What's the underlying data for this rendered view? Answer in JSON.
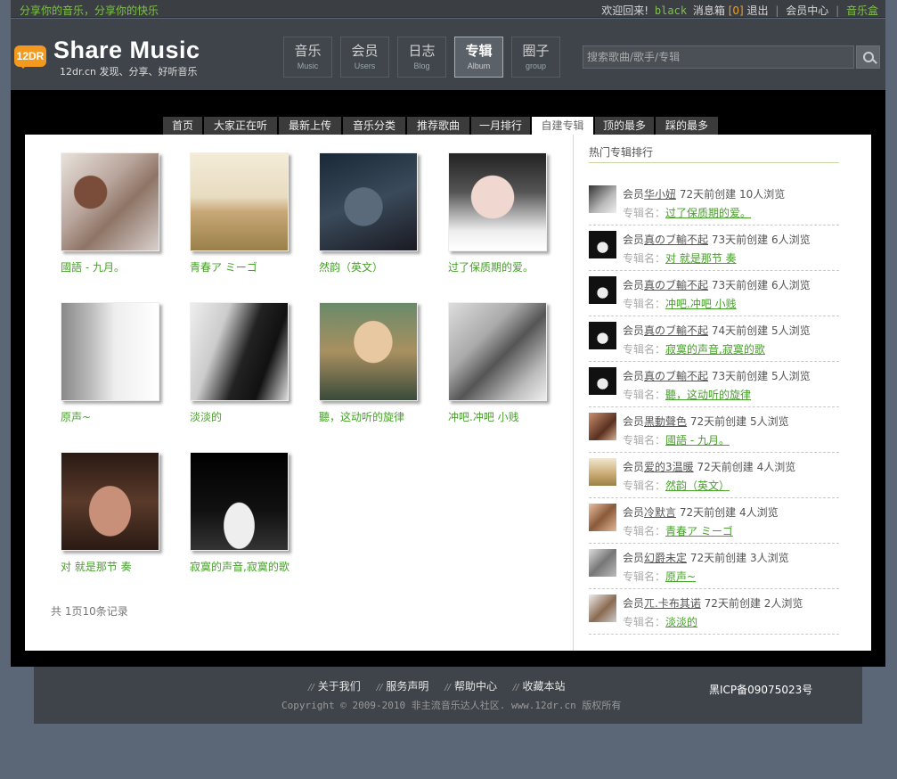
{
  "topbar": {
    "slogan": "分享你的音乐，分享你的快乐",
    "welcome": "欢迎回来!",
    "username": "black",
    "inbox_label": "消息箱",
    "inbox_count": "[0]",
    "logout": "退出",
    "member_center": "会员中心",
    "music_box": "音乐盒"
  },
  "header": {
    "logo_badge": "12DR",
    "logo_title": "Share Music",
    "logo_sub": "12dr.cn 发现、分享、好听音乐",
    "nav": [
      {
        "cn": "音乐",
        "en": "Music"
      },
      {
        "cn": "会员",
        "en": "Users"
      },
      {
        "cn": "日志",
        "en": "Blog"
      },
      {
        "cn": "专辑",
        "en": "Album"
      },
      {
        "cn": "圈子",
        "en": "group"
      }
    ],
    "active_nav": "Album",
    "search_placeholder": "搜索歌曲/歌手/专辑"
  },
  "subnav": [
    "首页",
    "大家正在听",
    "最新上传",
    "音乐分类",
    "推荐歌曲",
    "一月排行",
    "自建专辑",
    "顶的最多",
    "踩的最多"
  ],
  "subnav_active": "自建专辑",
  "albums": [
    {
      "title": "國語 - 九月。",
      "thumb": "photo-girl-with-record"
    },
    {
      "title": "青春ア ミーゴ",
      "thumb": "photo-field-couple"
    },
    {
      "title": "然韵（英文）",
      "thumb": "photo-dark-face"
    },
    {
      "title": "过了保质期的爱。",
      "thumb": "photo-girl-closeup"
    },
    {
      "title": "原声~",
      "thumb": "photo-girl-bw-side"
    },
    {
      "title": "淡淡的",
      "thumb": "photo-bw-hair"
    },
    {
      "title": "聽，这动听的旋律",
      "thumb": "photo-girl-headphones"
    },
    {
      "title": "冲吧.冲吧 小贱",
      "thumb": "photo-hand-strings"
    },
    {
      "title": "对 就是那节 奏",
      "thumb": "photo-girl-dark-eyes"
    },
    {
      "title": "寂寞的声音,寂寞的歌",
      "thumb": "photo-bw-crouching"
    }
  ],
  "pager": "共 1页10条记录",
  "hot": {
    "title": "热门专辑排行",
    "label_member": "会员",
    "label_album": "专辑名：",
    "items": [
      {
        "member": "华小妞",
        "created": "72天前创建",
        "views": "10人浏览",
        "album": "过了保质期的爱。"
      },
      {
        "member": "真のブ輸不起",
        "created": "73天前创建",
        "views": "6人浏览",
        "album": "对 就是那节 奏"
      },
      {
        "member": "真のブ輸不起",
        "created": "73天前创建",
        "views": "6人浏览",
        "album": "冲吧.冲吧 小贱"
      },
      {
        "member": "真のブ輸不起",
        "created": "74天前创建",
        "views": "5人浏览",
        "album": "寂寞的声音,寂寞的歌"
      },
      {
        "member": "真のブ輸不起",
        "created": "73天前创建",
        "views": "5人浏览",
        "album": "聽，这动听的旋律"
      },
      {
        "member": "黒動聲色",
        "created": "72天前创建",
        "views": "5人浏览",
        "album": "國語 - 九月。"
      },
      {
        "member": "爱的3温暖",
        "created": "72天前创建",
        "views": "4人浏览",
        "album": "然韵（英文）"
      },
      {
        "member": "冷默言",
        "created": "72天前创建",
        "views": "4人浏览",
        "album": "青春ア ミーゴ"
      },
      {
        "member": "幻爵未定",
        "created": "72天前创建",
        "views": "3人浏览",
        "album": "原声~"
      },
      {
        "member": "ㄫ.卡布其诺",
        "created": "72天前创建",
        "views": "2人浏览",
        "album": "淡淡的"
      }
    ]
  },
  "footer": {
    "links": [
      "关于我们",
      "服务声明",
      "帮助中心",
      "收藏本站"
    ],
    "copyright": "Copyright © 2009-2010 非主流音乐达人社区. www.12dr.cn 版权所有",
    "icp": "黑ICP备09075023号"
  }
}
